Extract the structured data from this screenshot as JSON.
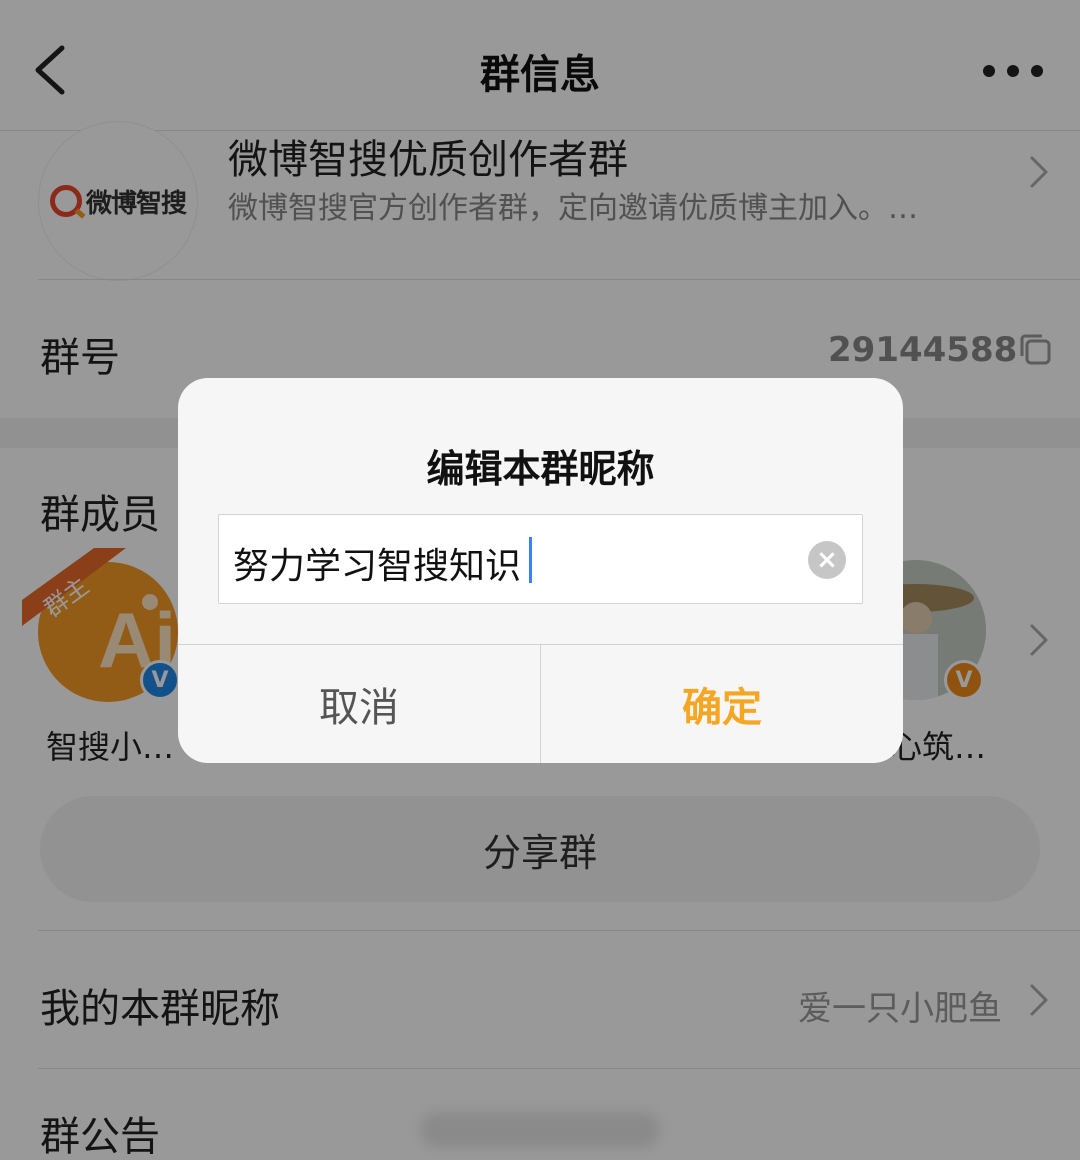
{
  "colors": {
    "accent": "#f5a623",
    "overlay": "rgba(0,0,0,0.40)",
    "verified_blue": "#1e88e5",
    "verified_orange": "#f08a1a"
  },
  "nav": {
    "title": "群信息",
    "back_icon": "chevron-left-icon",
    "more_icon": "more-dots-icon"
  },
  "group": {
    "logo_text": "微博智搜",
    "name": "微博智搜优质创作者群",
    "description": "微博智搜官方创作者群，定向邀请优质博主加入。…"
  },
  "group_number": {
    "label": "群号",
    "value": "29144588",
    "copy_icon": "copy-icon"
  },
  "members": {
    "label": "群成员（",
    "items": [
      {
        "name": "智搜小…",
        "role_badge": "群主",
        "verified": "blue"
      },
      {
        "name": "心筑…",
        "verified": "orange"
      }
    ]
  },
  "share_button": "分享群",
  "my_nickname": {
    "label": "我的本群昵称",
    "value": "爱一只小肥鱼"
  },
  "announcement": {
    "label": "群公告"
  },
  "dialog": {
    "title": "编辑本群昵称",
    "input_value": "努力学习智搜知识",
    "clear_icon": "×",
    "cancel": "取消",
    "confirm": "确定"
  }
}
